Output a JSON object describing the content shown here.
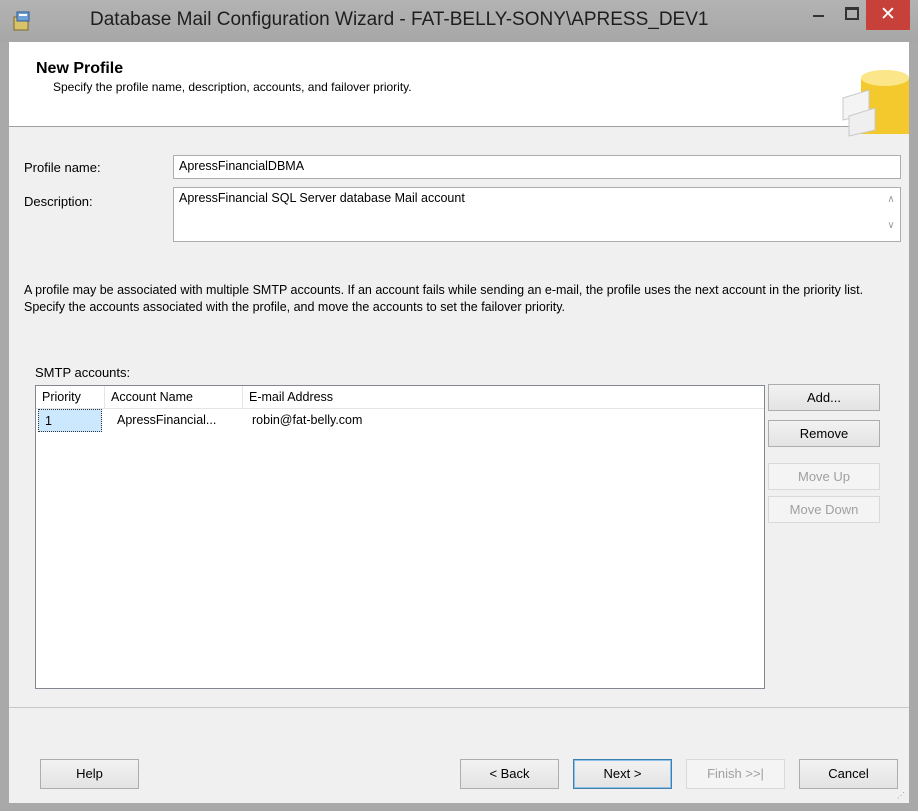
{
  "window": {
    "title": "Database Mail Configuration Wizard - FAT-BELLY-SONY\\APRESS_DEV1",
    "minimize_glyph": "",
    "close_glyph": "✕"
  },
  "header": {
    "title": "New Profile",
    "subtitle": "Specify the profile name, description, accounts, and failover priority."
  },
  "form": {
    "profile_name_label": "Profile name:",
    "profile_name_value": "ApressFinancialDBMA",
    "description_label": "Description:",
    "description_value": "ApressFinancial SQL Server database Mail account"
  },
  "info_text": "A profile may be associated with multiple SMTP accounts. If an account fails while sending an e-mail, the profile uses the next account in the priority list. Specify the accounts associated with the profile, and move the accounts to set the failover priority.",
  "smtp": {
    "label": "SMTP accounts:",
    "columns": [
      "Priority",
      "Account Name",
      "E-mail Address"
    ],
    "rows": [
      {
        "priority": "1",
        "account_name": "ApressFinancial...",
        "email": "robin@fat-belly.com"
      }
    ]
  },
  "side_buttons": {
    "add": "Add...",
    "remove": "Remove",
    "move_up": "Move Up",
    "move_down": "Move Down"
  },
  "footer_buttons": {
    "help": "Help",
    "back": "< Back",
    "next": "Next >",
    "finish": "Finish >>|",
    "cancel": "Cancel"
  },
  "icons": {
    "app": "wizard-app-icon",
    "database": "database-mail-icon"
  },
  "colors": {
    "close_button": "#c7413a",
    "selection": "#cce8ff",
    "header_bg": "#ffffff"
  }
}
